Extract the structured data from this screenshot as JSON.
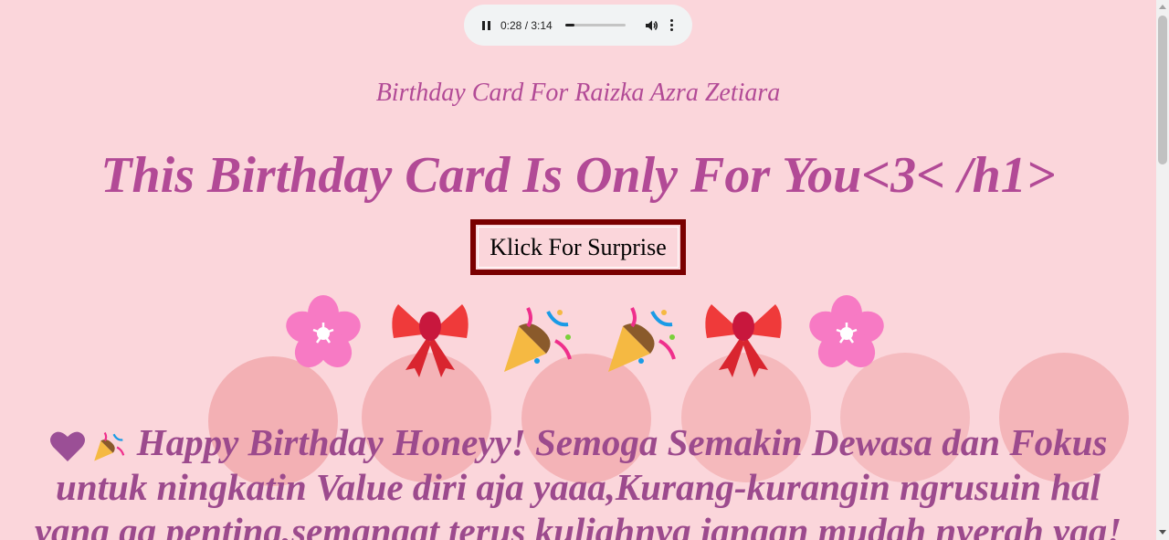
{
  "audio": {
    "time_display": "0:28 / 3:14",
    "progress_fraction": 0.149,
    "play_state": "pause-icon",
    "volume_icon": "volume-icon",
    "menu_icon": "more-vert-icon"
  },
  "card": {
    "subtitle": "Birthday Card For Raizka Azra Zetiara",
    "title": "This Birthday Card Is Only For You<3< /h1>",
    "surprise_button": "Klick For Surprise",
    "emojis": [
      "cherry-blossom-icon",
      "ribbon-icon",
      "party-popper-icon",
      "party-popper-icon",
      "ribbon-icon",
      "cherry-blossom-icon"
    ],
    "message_icons": [
      "purple-heart-icon",
      "party-popper-icon"
    ],
    "message_line1": "Happy Birthday Honeyy! Semoga Semakin Dewasa dan Fokus",
    "message_line2": "untuk ningkatin Value diri aja yaaa,Kurang-kurangin ngrusuin hal",
    "message_line3": "yang ga penting,semangat terus kuliahnya jangan mudah nyerah yaa!"
  },
  "colors": {
    "background": "#fbd6db",
    "heading": "#b24a96",
    "message": "#9c4a8d",
    "button_border": "#7a0000"
  }
}
